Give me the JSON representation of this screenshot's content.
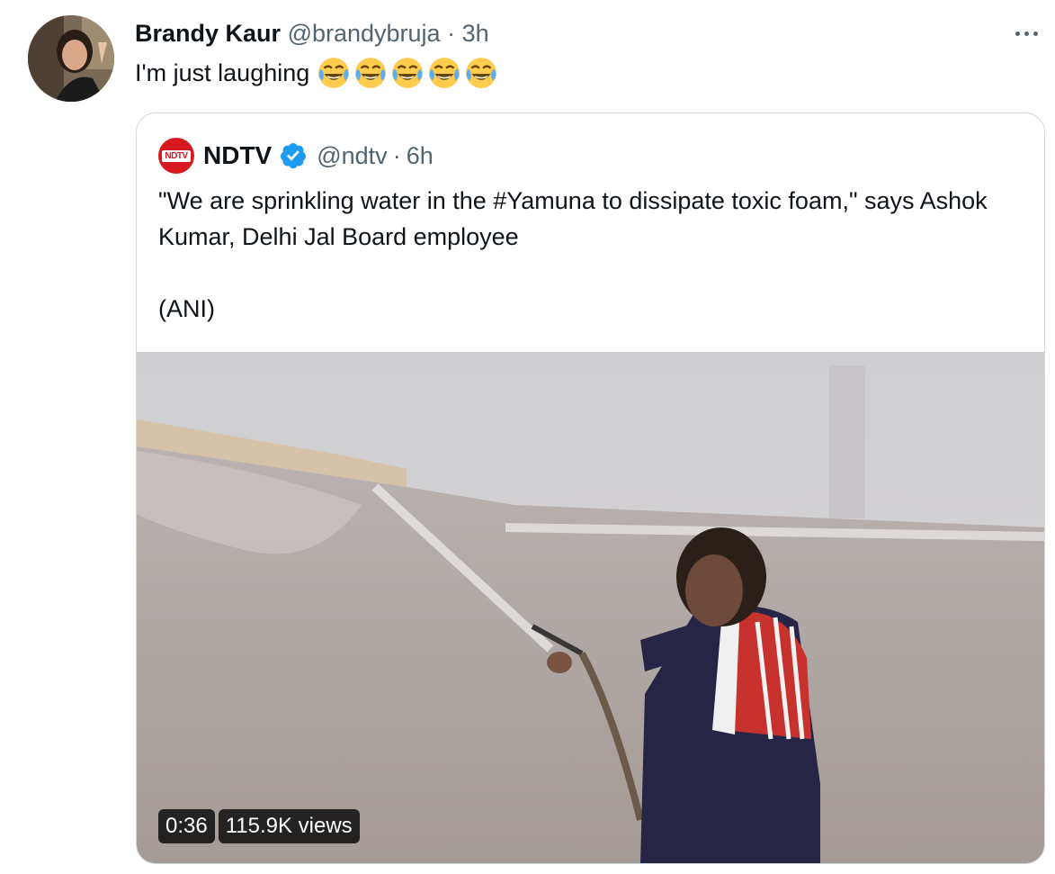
{
  "tweet": {
    "author_name": "Brandy Kaur",
    "author_handle": "@brandybruja",
    "separator": "·",
    "time": "3h",
    "text": "I'm just laughing",
    "emoji_icons": [
      "face-with-tears-of-joy-icon",
      "face-with-tears-of-joy-icon",
      "face-with-tears-of-joy-icon",
      "face-with-tears-of-joy-icon",
      "face-with-tears-of-joy-icon"
    ]
  },
  "quoted_tweet": {
    "author_name": "NDTV",
    "logo_text": "NDTV",
    "author_handle": "@ndtv",
    "separator": "·",
    "time": "6h",
    "text_line1": "\"We are sprinkling water in the #Yamuna to dissipate toxic foam,\" says Ashok Kumar, Delhi Jal Board employee",
    "text_line2": "(ANI)",
    "video": {
      "duration": "0:36",
      "views": "115.9K views"
    }
  },
  "colors": {
    "text_primary": "#0f1419",
    "text_secondary": "#536471",
    "border": "#cfd9de",
    "verified_blue": "#1d9bf0",
    "ndtv_red": "#d71920"
  }
}
